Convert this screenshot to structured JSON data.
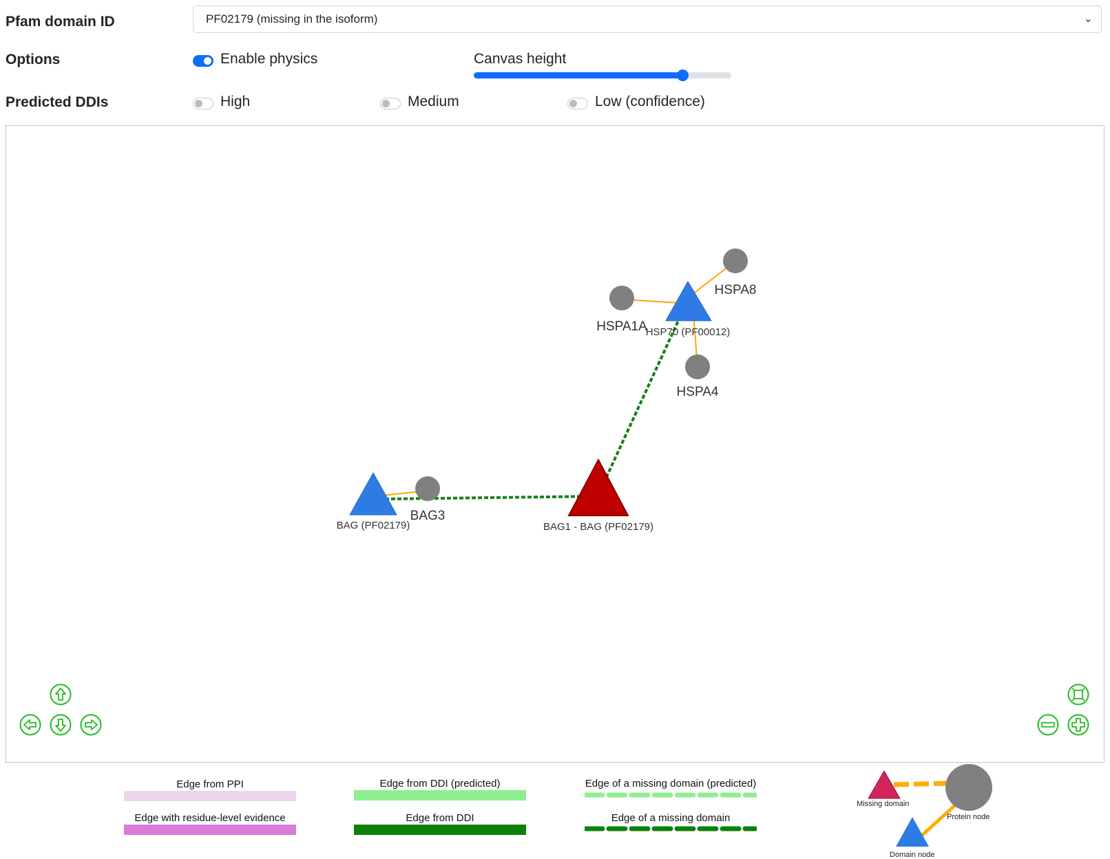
{
  "form": {
    "pfam_label": "Pfam domain ID",
    "pfam_value": "PF02179 (missing in the isoform)",
    "options_label": "Options",
    "enable_physics_label": "Enable physics",
    "enable_physics_on": true,
    "canvas_height_label": "Canvas height",
    "canvas_height_fraction": 0.81,
    "predicted_label": "Predicted DDIs",
    "confidence": {
      "high": "High",
      "medium": "Medium",
      "low": "Low (confidence)"
    }
  },
  "network": {
    "nodes": {
      "hsp70": "HSP70 (PF00012)",
      "hspa8": "HSPA8",
      "hspa1a": "HSPA1A",
      "hspa4": "HSPA4",
      "bag3": "BAG3",
      "bag": "BAG (PF02179)",
      "bag1": "BAG1 - BAG (PF02179)"
    },
    "colors": {
      "protein_node": "#808080",
      "domain_node": "#2f7be6",
      "missing_domain_node": "#c00000",
      "ppi_edge": "#ffa500",
      "ddi_edge": "#1a7f1a",
      "nav_buttons": "#22bb22"
    }
  },
  "legend": {
    "ppi": "Edge from PPI",
    "residue": "Edge with residue-level evidence",
    "ddi_pred": "Edge from DDI (predicted)",
    "ddi": "Edge from DDI",
    "missing_pred": "Edge of a missing domain (predicted)",
    "missing": "Edge of a missing domain",
    "missing_domain": "Missing domain",
    "protein_node": "Protein node",
    "domain_node": "Domain node",
    "colors": {
      "ppi": "#ecd5ea",
      "residue": "#d97ad6",
      "ddi_pred": "#90ee90",
      "ddi": "#0a820a",
      "missing_pred": "#90ee90",
      "missing": "#0a820a",
      "missing_domain_icon": "#d0245a",
      "protein_icon": "#808080",
      "domain_icon": "#2f7be6",
      "icon_edge": "#ffad00"
    }
  }
}
